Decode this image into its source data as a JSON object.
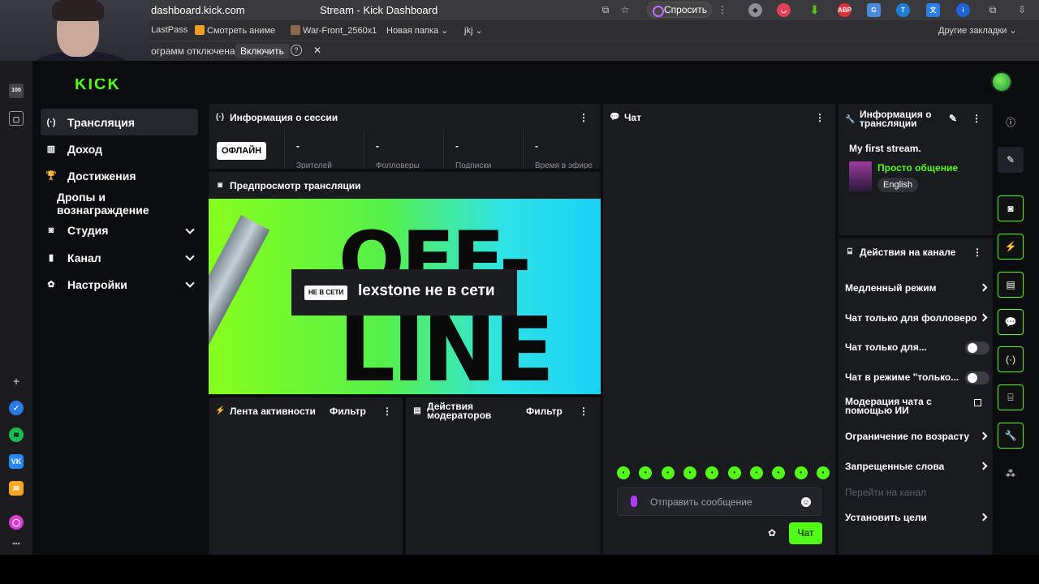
{
  "browser": {
    "url": "dashboard.kick.com",
    "tab_title": "Stream - Kick Dashboard",
    "ask_label": "Спросить",
    "extensions": [
      "ABP",
      "T"
    ],
    "bookmarks": [
      "LastPass",
      "Смотреть аниме",
      "War-Front_2560x1",
      "Новая папка",
      "jkj"
    ],
    "other_bookmarks": "Другие закладки",
    "infobar_text": "ограмм отключена",
    "infobar_button": "Включить",
    "infobar_help": "?"
  },
  "dock": {
    "badge": "100"
  },
  "nav": {
    "items": [
      {
        "label": "Трансляция",
        "icon": "broadcast-icon"
      },
      {
        "label": "Доход",
        "icon": "revenue-icon"
      },
      {
        "label": "Достижения",
        "icon": "trophy-icon"
      },
      {
        "label": "Дропы и вознаграждение",
        "icon": ""
      },
      {
        "label": "Студия",
        "icon": "studio-icon"
      },
      {
        "label": "Канал",
        "icon": "channel-icon"
      },
      {
        "label": "Настройки",
        "icon": "gear-icon"
      }
    ]
  },
  "session": {
    "title": "Информация о сессии",
    "status": "ОФЛАЙН",
    "stats": [
      {
        "value": "-",
        "label": "Зрителей"
      },
      {
        "value": "-",
        "label": "Фолловеры"
      },
      {
        "value": "-",
        "label": "Подписки"
      },
      {
        "value": "-",
        "label": "Время в эфире"
      }
    ]
  },
  "preview": {
    "title": "Предпросмотр трансляции",
    "offline_badge": "НЕ В СЕТИ",
    "offline_text": "lexstone не в сети",
    "bg_word_1": "OFF-",
    "bg_word_2": "LINE"
  },
  "activity": {
    "title": "Лента активности",
    "filter": "Фильтр"
  },
  "mod_actions": {
    "title_line1": "Действия",
    "title_line2": "модераторов",
    "filter": "Фильтр"
  },
  "chat": {
    "title": "Чат",
    "placeholder": "Отправить сообщение",
    "send_label": "Чат",
    "emote_count": 10
  },
  "stream_info": {
    "title_line1": "Информация о",
    "title_line2": "трансляции",
    "stream_title": "My first stream.",
    "category": "Просто общение",
    "language": "English"
  },
  "channel_actions": {
    "title": "Действия на канале",
    "rows": [
      {
        "label": "Медленный режим",
        "control": "chevron"
      },
      {
        "label": "Чат только для фолловеро",
        "control": "chevron"
      },
      {
        "label": "Чат только для...",
        "control": "toggle"
      },
      {
        "label": "Чат в режиме \"только...",
        "control": "toggle"
      },
      {
        "label": "Модерация чата с помощью ИИ",
        "control": "external"
      },
      {
        "label": "Ограничение по возрасту",
        "control": "chevron"
      },
      {
        "label": "Запрещенные слова",
        "control": "chevron"
      },
      {
        "label": "Перейти на канал",
        "control": "none"
      },
      {
        "label": "Установить цели",
        "control": "chevron"
      }
    ]
  },
  "colors": {
    "accent": "#53fc18",
    "panel": "#191b1f",
    "bg": "#0b0c0d"
  }
}
